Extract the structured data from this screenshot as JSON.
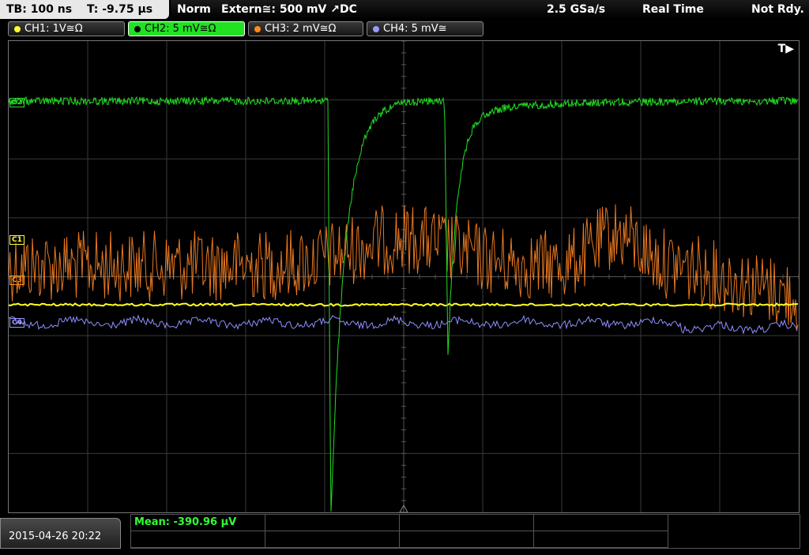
{
  "topbar": {
    "timebase": "TB: 100 ns",
    "trigger_time": "T: -9.75 µs",
    "mode": "Norm",
    "trigger_source": "Extern≅: 500 mV ↗DC",
    "sample_rate": "2.5 GSa/s",
    "acq_mode": "Real Time",
    "status": "Not Rdy."
  },
  "channels": [
    {
      "label": "CH1: 1V≅Ω",
      "color": "#ffff33",
      "active": false
    },
    {
      "label": "CH2: 5 mV≅Ω",
      "color": "#33dd33",
      "active": true
    },
    {
      "label": "CH3: 2 mV≅Ω",
      "color": "#ff8c1a",
      "active": false
    },
    {
      "label": "CH4: 5 mV≅",
      "color": "#9a9aff",
      "active": false
    }
  ],
  "markers": {
    "c2": "C2",
    "c1": "C1",
    "c3": "C3",
    "c4": "C4",
    "trigger": "T▶"
  },
  "bottombar": {
    "datetime": "2015-04-26 20:22",
    "measurement": "Mean: -390.96 µV"
  }
}
